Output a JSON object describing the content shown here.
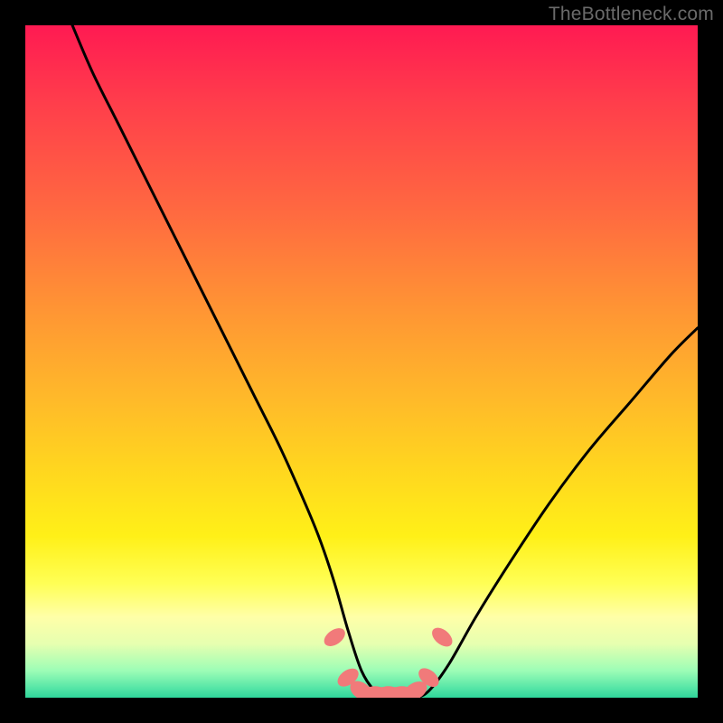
{
  "watermark_text": "TheBottleneck.com",
  "chart_data": {
    "type": "line",
    "title": "",
    "xlabel": "",
    "ylabel": "",
    "xlim": [
      0,
      100
    ],
    "ylim": [
      0,
      100
    ],
    "series": [
      {
        "name": "bottleneck-curve",
        "x": [
          7,
          10,
          14,
          18,
          22,
          26,
          30,
          34,
          38,
          42,
          44,
          46,
          48,
          50,
          52,
          54,
          56,
          58,
          60,
          63,
          67,
          72,
          78,
          84,
          90,
          96,
          100
        ],
        "y": [
          100,
          93,
          85,
          77,
          69,
          61,
          53,
          45,
          37,
          28,
          23,
          17,
          10,
          4,
          1,
          0,
          0,
          0,
          1,
          5,
          12,
          20,
          29,
          37,
          44,
          51,
          55
        ]
      }
    ],
    "band": {
      "name": "optimal-zone",
      "x": [
        46,
        48,
        50,
        52,
        54,
        56,
        58,
        60,
        62
      ],
      "y": [
        9,
        3,
        1,
        0.5,
        0.5,
        0.5,
        1,
        3,
        9
      ]
    },
    "colors": {
      "curve": "#000000",
      "band_fill": "#f17a7a"
    }
  }
}
